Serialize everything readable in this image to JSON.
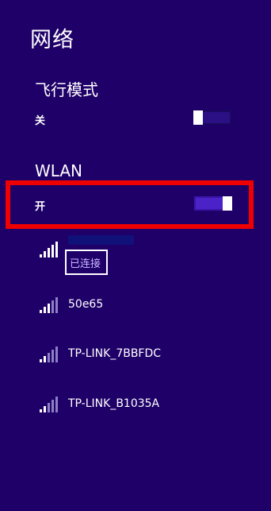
{
  "panel": {
    "title": "网络"
  },
  "airplane_mode": {
    "title": "飞行模式",
    "state_label": "关",
    "is_on": false
  },
  "wlan": {
    "title": "WLAN",
    "state_label": "开",
    "is_on": true
  },
  "networks": [
    {
      "name": "",
      "status": "已连接",
      "signal_icon": "wifi-signal-icon",
      "signal_bars": 5,
      "connected": true
    },
    {
      "name": "50e65",
      "signal_icon": "wifi-signal-icon",
      "signal_bars": 3
    },
    {
      "name": "TP-LINK_7BBFDC",
      "signal_icon": "wifi-signal-icon",
      "signal_bars": 2
    },
    {
      "name": "TP-LINK_B1035A",
      "signal_icon": "wifi-signal-icon",
      "signal_bars": 2
    }
  ],
  "colors": {
    "background": "#1f0068",
    "toggle_on": "#4a22c8",
    "toggle_off": "#2b0f84",
    "highlight": "#ee0000",
    "signal_full": "#ffffff",
    "signal_dim": "#8c7fc4"
  }
}
